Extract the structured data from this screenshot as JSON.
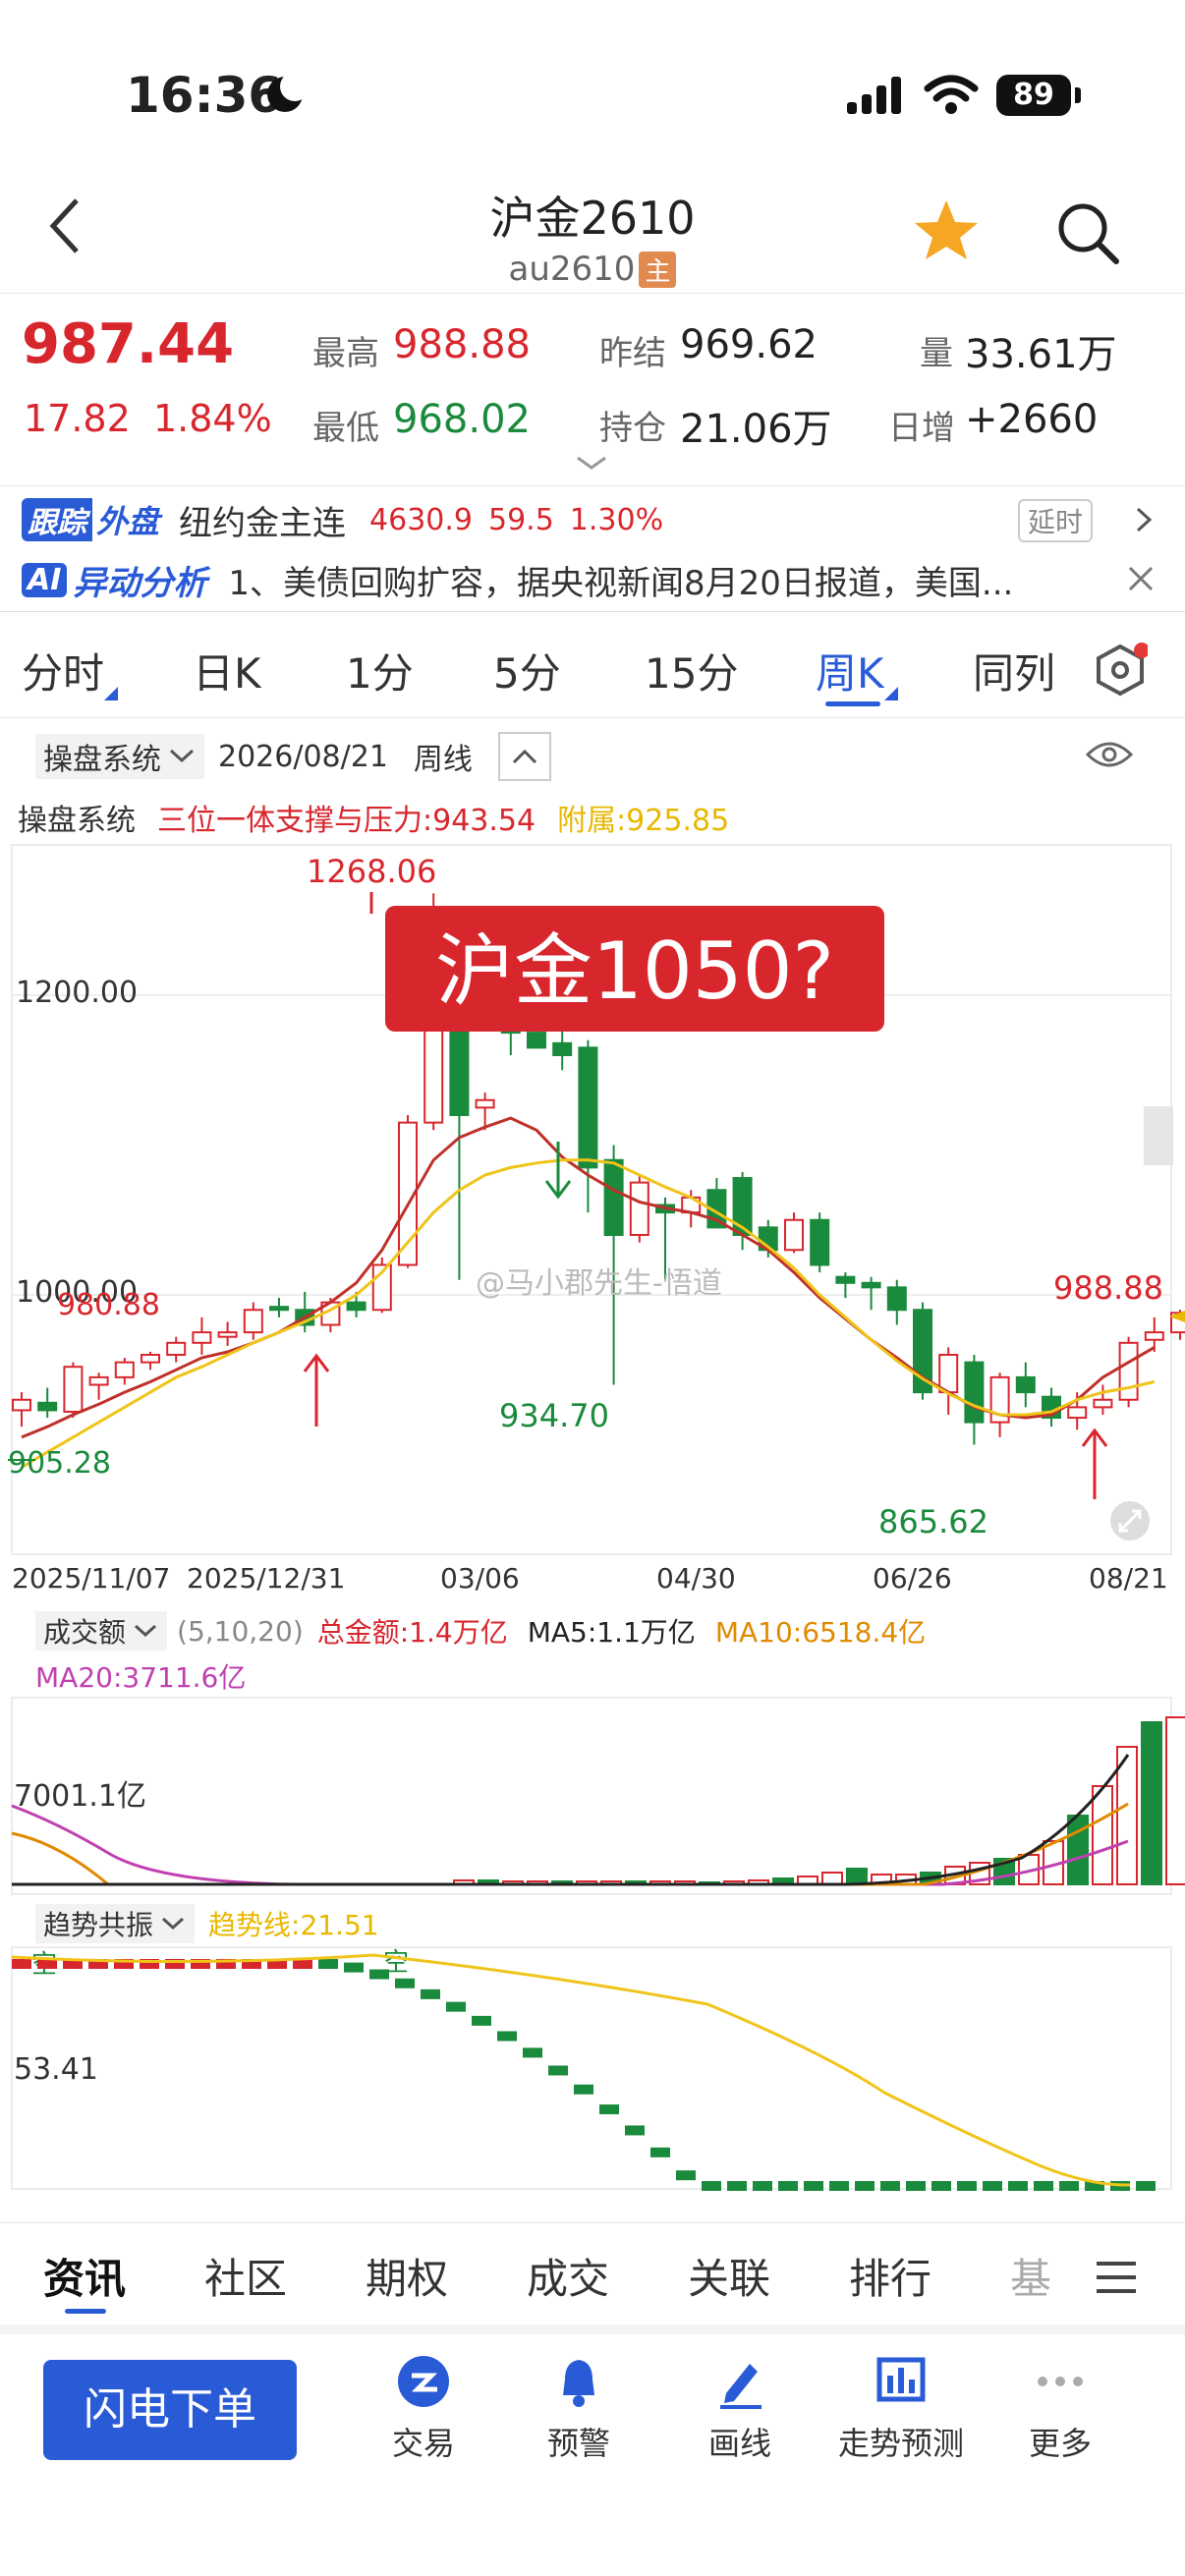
{
  "status_bar": {
    "time": "16:36",
    "battery": "89"
  },
  "header": {
    "title": "沪金2610",
    "code": "au2610",
    "main_badge": "主"
  },
  "quote": {
    "price": "987.44",
    "change": "17.82",
    "change_pct": "1.84%",
    "high_label": "最高",
    "high": "988.88",
    "low_label": "最低",
    "low": "968.02",
    "settle_label": "昨结",
    "settle": "969.62",
    "oi_label": "持仓",
    "oi": "21.06万",
    "vol_label": "量",
    "vol": "33.61万",
    "daily_inc_label": "日增",
    "daily_inc": "+2660"
  },
  "ticker": {
    "badge1": "跟踪",
    "badge2": "外盘",
    "name": "纽约金主连",
    "price": "4630.9",
    "change": "59.5",
    "pct": "1.30%",
    "delay": "延时"
  },
  "ai": {
    "badge": "AI",
    "title": "异动分析",
    "text": "1、美债回购扩容，据央视新闻8月20日报道，美国..."
  },
  "period_tabs": [
    {
      "label": "分时"
    },
    {
      "label": "日K"
    },
    {
      "label": "1分"
    },
    {
      "label": "5分"
    },
    {
      "label": "15分"
    },
    {
      "label": "周K",
      "active": true
    },
    {
      "label": "同列"
    }
  ],
  "chart_header": {
    "system": "操盘系统",
    "date": "2026/08/21",
    "period": "周线"
  },
  "indicator_line": {
    "name": "操盘系统",
    "support": "三位一体支撑与压力:943.54",
    "attach": "附属:925.85"
  },
  "chart_data": {
    "type": "candlestick",
    "ylabels": [
      "1200.00",
      "1000.00"
    ],
    "xlabels": [
      "2025/11/07",
      "2025/12/31",
      "03/06",
      "04/30",
      "06/26",
      "08/21"
    ],
    "annotations": [
      "1268.06",
      "980.88",
      "905.28",
      "934.70",
      "865.62",
      "988.88"
    ],
    "overlay_title": "沪金1050?",
    "watermark": "@马小郡先生-悟道",
    "candles": [
      [
        923,
        935,
        912,
        930
      ],
      [
        928,
        938,
        918,
        923
      ],
      [
        922,
        955,
        918,
        952
      ],
      [
        940,
        948,
        930,
        945
      ],
      [
        945,
        958,
        940,
        955
      ],
      [
        955,
        962,
        950,
        960
      ],
      [
        960,
        972,
        955,
        968
      ],
      [
        968,
        985,
        960,
        975
      ],
      [
        972,
        982,
        966,
        975
      ],
      [
        975,
        995,
        970,
        990
      ],
      [
        992,
        998,
        985,
        990
      ],
      [
        990,
        1002,
        975,
        980
      ],
      [
        980,
        998,
        975,
        995
      ],
      [
        995,
        1002,
        985,
        990
      ],
      [
        990,
        1025,
        988,
        1020
      ],
      [
        1020,
        1120,
        1018,
        1115
      ],
      [
        1115,
        1268,
        1110,
        1180
      ],
      [
        1180,
        1190,
        1010,
        1120
      ],
      [
        1125,
        1135,
        1110,
        1130
      ],
      [
        1180,
        1195,
        1160,
        1175
      ],
      [
        1175,
        1200,
        1165,
        1165
      ],
      [
        1168,
        1185,
        1150,
        1160
      ],
      [
        1165,
        1170,
        1055,
        1085
      ],
      [
        1090,
        1100,
        940,
        1040
      ],
      [
        1040,
        1080,
        1035,
        1075
      ],
      [
        1060,
        1065,
        1010,
        1055
      ],
      [
        1055,
        1070,
        1045,
        1065
      ],
      [
        1070,
        1078,
        1050,
        1045
      ],
      [
        1078,
        1082,
        1030,
        1040
      ],
      [
        1045,
        1050,
        1025,
        1030
      ],
      [
        1030,
        1055,
        1028,
        1050
      ],
      [
        1050,
        1055,
        1015,
        1020
      ],
      [
        1012,
        1015,
        998,
        1008
      ],
      [
        1008,
        1012,
        990,
        1005
      ],
      [
        1005,
        1010,
        980,
        990
      ],
      [
        990,
        995,
        930,
        935
      ],
      [
        935,
        965,
        920,
        960
      ],
      [
        955,
        960,
        900,
        915
      ],
      [
        915,
        948,
        905,
        945
      ],
      [
        945,
        955,
        925,
        935
      ],
      [
        932,
        938,
        912,
        918
      ],
      [
        918,
        935,
        910,
        925
      ],
      [
        925,
        940,
        920,
        930
      ],
      [
        930,
        972,
        925,
        968
      ],
      [
        970,
        985,
        962,
        975
      ],
      [
        975,
        990,
        970,
        988
      ]
    ],
    "ma_red": [
      905,
      912,
      920,
      927,
      935,
      942,
      950,
      958,
      962,
      968,
      975,
      985,
      995,
      1008,
      1030,
      1060,
      1090,
      1105,
      1112,
      1118,
      1110,
      1092,
      1080,
      1070,
      1062,
      1058,
      1055,
      1050,
      1040,
      1030,
      1015,
      998,
      984,
      970,
      958,
      945,
      935,
      925,
      920,
      918,
      920,
      930,
      945,
      955,
      965
    ],
    "ma_yellow": [
      885,
      895,
      905,
      915,
      925,
      935,
      945,
      952,
      960,
      968,
      975,
      982,
      990,
      1000,
      1015,
      1035,
      1055,
      1070,
      1080,
      1085,
      1088,
      1090,
      1090,
      1088,
      1080,
      1072,
      1065,
      1055,
      1045,
      1032,
      1018,
      1000,
      985,
      970,
      956,
      944,
      934,
      926,
      920,
      920,
      922,
      930,
      935,
      938,
      942
    ]
  },
  "volume": {
    "label": "成交额",
    "params": "(5,10,20)",
    "total": "总金额:1.4万亿",
    "ma5": "MA5:1.1万亿",
    "ma10": "MA10:6518.4亿",
    "ma20": "MA20:3711.6亿",
    "scale": "7001.1亿"
  },
  "trend": {
    "label": "趋势共振",
    "line": "趋势线:21.51",
    "scale": "53.41",
    "mark": "空"
  },
  "bottom_tabs": [
    {
      "label": "资讯",
      "active": true
    },
    {
      "label": "社区"
    },
    {
      "label": "期权"
    },
    {
      "label": "成交"
    },
    {
      "label": "关联"
    },
    {
      "label": "排行"
    },
    {
      "label": "基"
    }
  ],
  "bottom_bar": {
    "order": "闪电下单",
    "actions": [
      {
        "label": "交易"
      },
      {
        "label": "预警"
      },
      {
        "label": "画线"
      },
      {
        "label": "走势预测"
      },
      {
        "label": "更多"
      }
    ]
  }
}
